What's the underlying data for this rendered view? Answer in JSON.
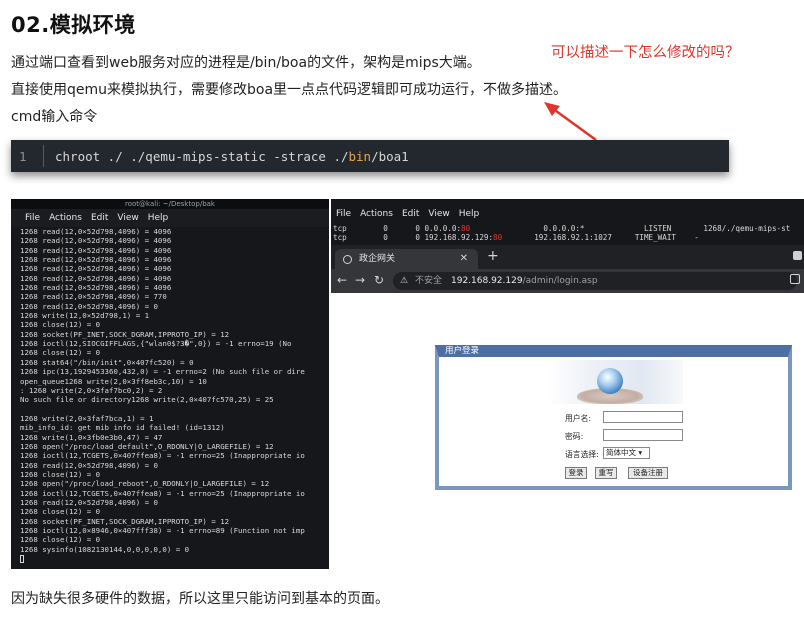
{
  "article": {
    "heading": "02.模拟环境",
    "para1": "通过端口查看到web服务对应的进程是/bin/boa的文件，架构是mips大端。",
    "para2": "直接使用qemu来模拟执行，需要修改boa里一点点代码逻辑即可成功运行，不做多描述。",
    "para3": "cmd输入命令",
    "annotation": "可以描述一下怎么修改的吗？",
    "footer": "因为缺失很多硬件的数据，所以这里只能访问到基本的页面。"
  },
  "code": {
    "line_number": "1",
    "pre": "chroot ./ ./qemu-mips-static -strace ./",
    "kw": "bin",
    "post": "/boa1"
  },
  "left_terminal": {
    "title": "root@kali: ~/Desktop/bak",
    "menu": [
      "File",
      "Actions",
      "Edit",
      "View",
      "Help"
    ],
    "lines": [
      "1268 read(12,0×52d798,4096) = 4096",
      "1268 read(12,0×52d798,4096) = 4096",
      "1268 read(12,0×52d798,4096) = 4096",
      "1268 read(12,0×52d798,4096) = 4096",
      "1268 read(12,0×52d798,4096) = 4096",
      "1268 read(12,0×52d798,4096) = 4096",
      "1268 read(12,0×52d798,4096) = 4096",
      "1268 read(12,0×52d798,4096) = 770",
      "1268 read(12,0×52d798,4096) = 0",
      "1268 write(12,0×52d798,1) = 1",
      "1268 close(12) = 0",
      "1268 socket(PF_INET,SOCK_DGRAM,IPPROTO_IP) = 12",
      "1268 ioctl(12,SIOCGIFFLAGS,{\"wlan0$?3�\",0}) = -1 errno=19 (No",
      "1268 close(12) = 0",
      "1268 stat64(\"/bin/init\",0×407fc520) = 0",
      "1268 ipc(13,1929453360,432,0) = -1 errno=2 (No such file or dire",
      "open_queue1268 write(2,0×3ff8eb3c,10) = 10",
      ": 1268 write(2,0×3faf7bc0,2) = 2",
      "No such file or directory1268 write(2,0×407fc570,25) = 25",
      "",
      "1268 write(2,0×3faf7bca,1) = 1",
      "mib_info_id: get mib info id failed! (id=1312)",
      "1268 write(1,0×3fb0e3b0,47) = 47",
      "1268 open(\"/proc/load_default\",O_RDONLY|O_LARGEFILE) = 12",
      "1268 ioctl(12,TCGETS,0×407ffea8) = -1 errno=25 (Inappropriate io",
      "1268 read(12,0×52d798,4096) = 0",
      "1268 close(12) = 0",
      "1268 open(\"/proc/load_reboot\",O_RDONLY|O_LARGEFILE) = 12",
      "1268 ioctl(12,TCGETS,0×407ffea8) = -1 errno=25 (Inappropriate io",
      "1268 read(12,0×52d798,4096) = 0",
      "1268 close(12) = 0",
      "1268 socket(PF_INET,SOCK_DGRAM,IPPROTO_IP) = 12",
      "1268 ioctl(12,0×8946,0×407fff38) = -1 errno=89 (Function not imp",
      "1268 close(12) = 0",
      "1268 sysinfo(1082130144,0,0,0,0,0) = 0"
    ]
  },
  "right_terminal": {
    "menu": [
      "File",
      "Actions",
      "Edit",
      "View",
      "Help"
    ],
    "net1": {
      "proto": "tcp",
      "q": "0",
      "s": "0",
      "local": "0.0.0.0:",
      "local_port": "80",
      "foreign": "0.0.0.0:*",
      "state": "LISTEN",
      "prog": "1268/./qemu-mips-st"
    },
    "net2": {
      "proto": "tcp",
      "q": "0",
      "s": "0",
      "local": "192.168.92.129:",
      "local_port": "80",
      "foreign": "192.168.92.1:1027",
      "state": "TIME_WAIT",
      "prog": "-"
    }
  },
  "browser": {
    "tab_title": "政企网关",
    "insecure": "不安全",
    "host": "192.168.92.129",
    "path": "/admin/login.asp",
    "panel_title": "用户登录",
    "username_label": "用户名:",
    "password_label": "密码:",
    "language_label": "语言选择:",
    "language_value": "简体中文",
    "login_btn": "登录",
    "reset_btn": "重写",
    "manager_btn": "设备注册"
  },
  "colors": {
    "annotation": "#e0352b",
    "code_bg": "#23272e",
    "panel_border": "#4d6fa3"
  }
}
